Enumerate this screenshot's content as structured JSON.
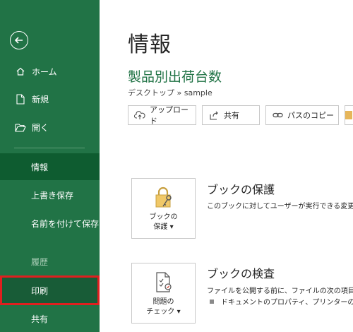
{
  "sidebar": {
    "back_label": "back",
    "items": [
      {
        "label": "ホーム",
        "icon": "home-icon"
      },
      {
        "label": "新規",
        "icon": "new-document-icon"
      },
      {
        "label": "開く",
        "icon": "open-folder-icon"
      },
      {
        "label": "情報"
      },
      {
        "label": "上書き保存"
      },
      {
        "label": "名前を付けて保存"
      },
      {
        "label": "履歴"
      },
      {
        "label": "印刷"
      },
      {
        "label": "共有"
      }
    ]
  },
  "main": {
    "page_title": "情報",
    "doc_title": "製品別出荷台数",
    "doc_path": "デスクトップ » sample",
    "actions": [
      {
        "label": "アップロード",
        "icon": "upload-icon"
      },
      {
        "label": "共有",
        "icon": "share-icon"
      },
      {
        "label": "パスのコピー",
        "icon": "link-icon"
      }
    ],
    "protect": {
      "tile_line1": "ブックの",
      "tile_line2": "保護 ▾",
      "heading": "ブックの保護",
      "desc": "このブックに対してユーザーが実行できる変更"
    },
    "inspect": {
      "tile_line1": "問題の",
      "tile_line2": "チェック ▾",
      "heading": "ブックの検査",
      "desc": "ファイルを公開する前に、ファイルの次の項目",
      "bullet": "ドキュメントのプロパティ、プリンターのパス"
    }
  },
  "colors": {
    "sidebar_bg": "#217346",
    "selected_bg": "#0e5c30",
    "highlight_border": "#e01f1f",
    "doc_title": "#217346"
  }
}
